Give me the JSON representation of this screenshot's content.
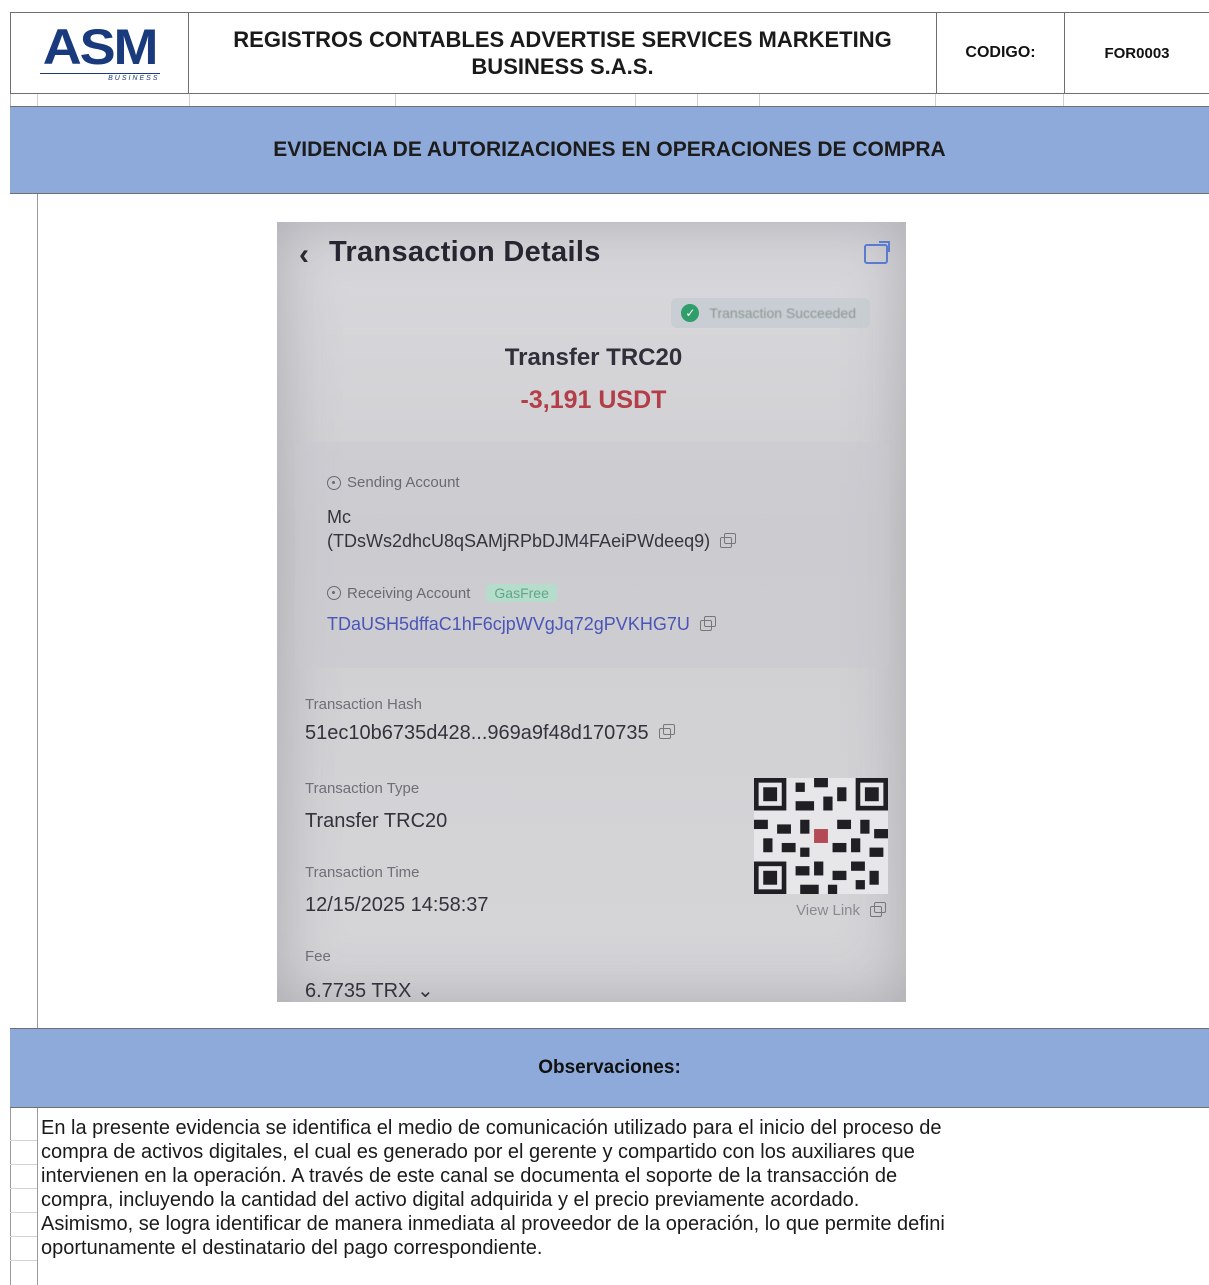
{
  "header": {
    "logo_text": "ASM",
    "logo_subtext": "BUSINESS",
    "title": "REGISTROS CONTABLES ADVERTISE SERVICES MARKETING BUSINESS S.A.S.",
    "code_label": "CODIGO:",
    "code_value": "FOR0003"
  },
  "section_title": "EVIDENCIA DE AUTORIZACIONES EN OPERACIONES DE COMPRA",
  "transaction": {
    "screen_title": "Transaction Details",
    "status": "Transaction Succeeded",
    "type_summary": "Transfer TRC20",
    "amount": "-3,191 USDT",
    "sending_label": "Sending Account",
    "sending_name": "Mc",
    "sending_address": "(TDsWs2dhcU8qSAMjRPbDJM4FAeiPWdeeq9)",
    "receiving_label": "Receiving Account",
    "receiving_tag": "GasFree",
    "receiving_address": "TDaUSH5dffaC1hF6cjpWVgJq72gPVKHG7U",
    "hash_label": "Transaction Hash",
    "hash_value": "51ec10b6735d428...969a9f48d170735",
    "type_label": "Transaction Type",
    "type_value": "Transfer TRC20",
    "time_label": "Transaction Time",
    "time_value": "12/15/2025 14:58:37",
    "fee_label": "Fee",
    "fee_value": "6.7735 TRX",
    "view_link": "View Link"
  },
  "observations_title": "Observaciones:",
  "observations_text": "En la presente evidencia se identifica el medio de comunicación utilizado para el inicio del proceso de\ncompra de activos digitales, el cual es generado por el gerente y compartido con los auxiliares que\nintervienen en la operación. A través de este canal se documenta el soporte de la transacción de\ncompra, incluyendo la cantidad del activo digital adquirida y el precio previamente acordado.\nAsimismo, se logra identificar de manera inmediata al proveedor de la operación, lo que permite defini\noportunamente el destinatario del pago correspondiente.",
  "colors": {
    "band_blue": "#8eaadb",
    "logo_blue": "#1a3a7e",
    "amount_red": "#b33e48",
    "address_blue": "#4a55b8",
    "success_green": "#2f9e6b"
  }
}
